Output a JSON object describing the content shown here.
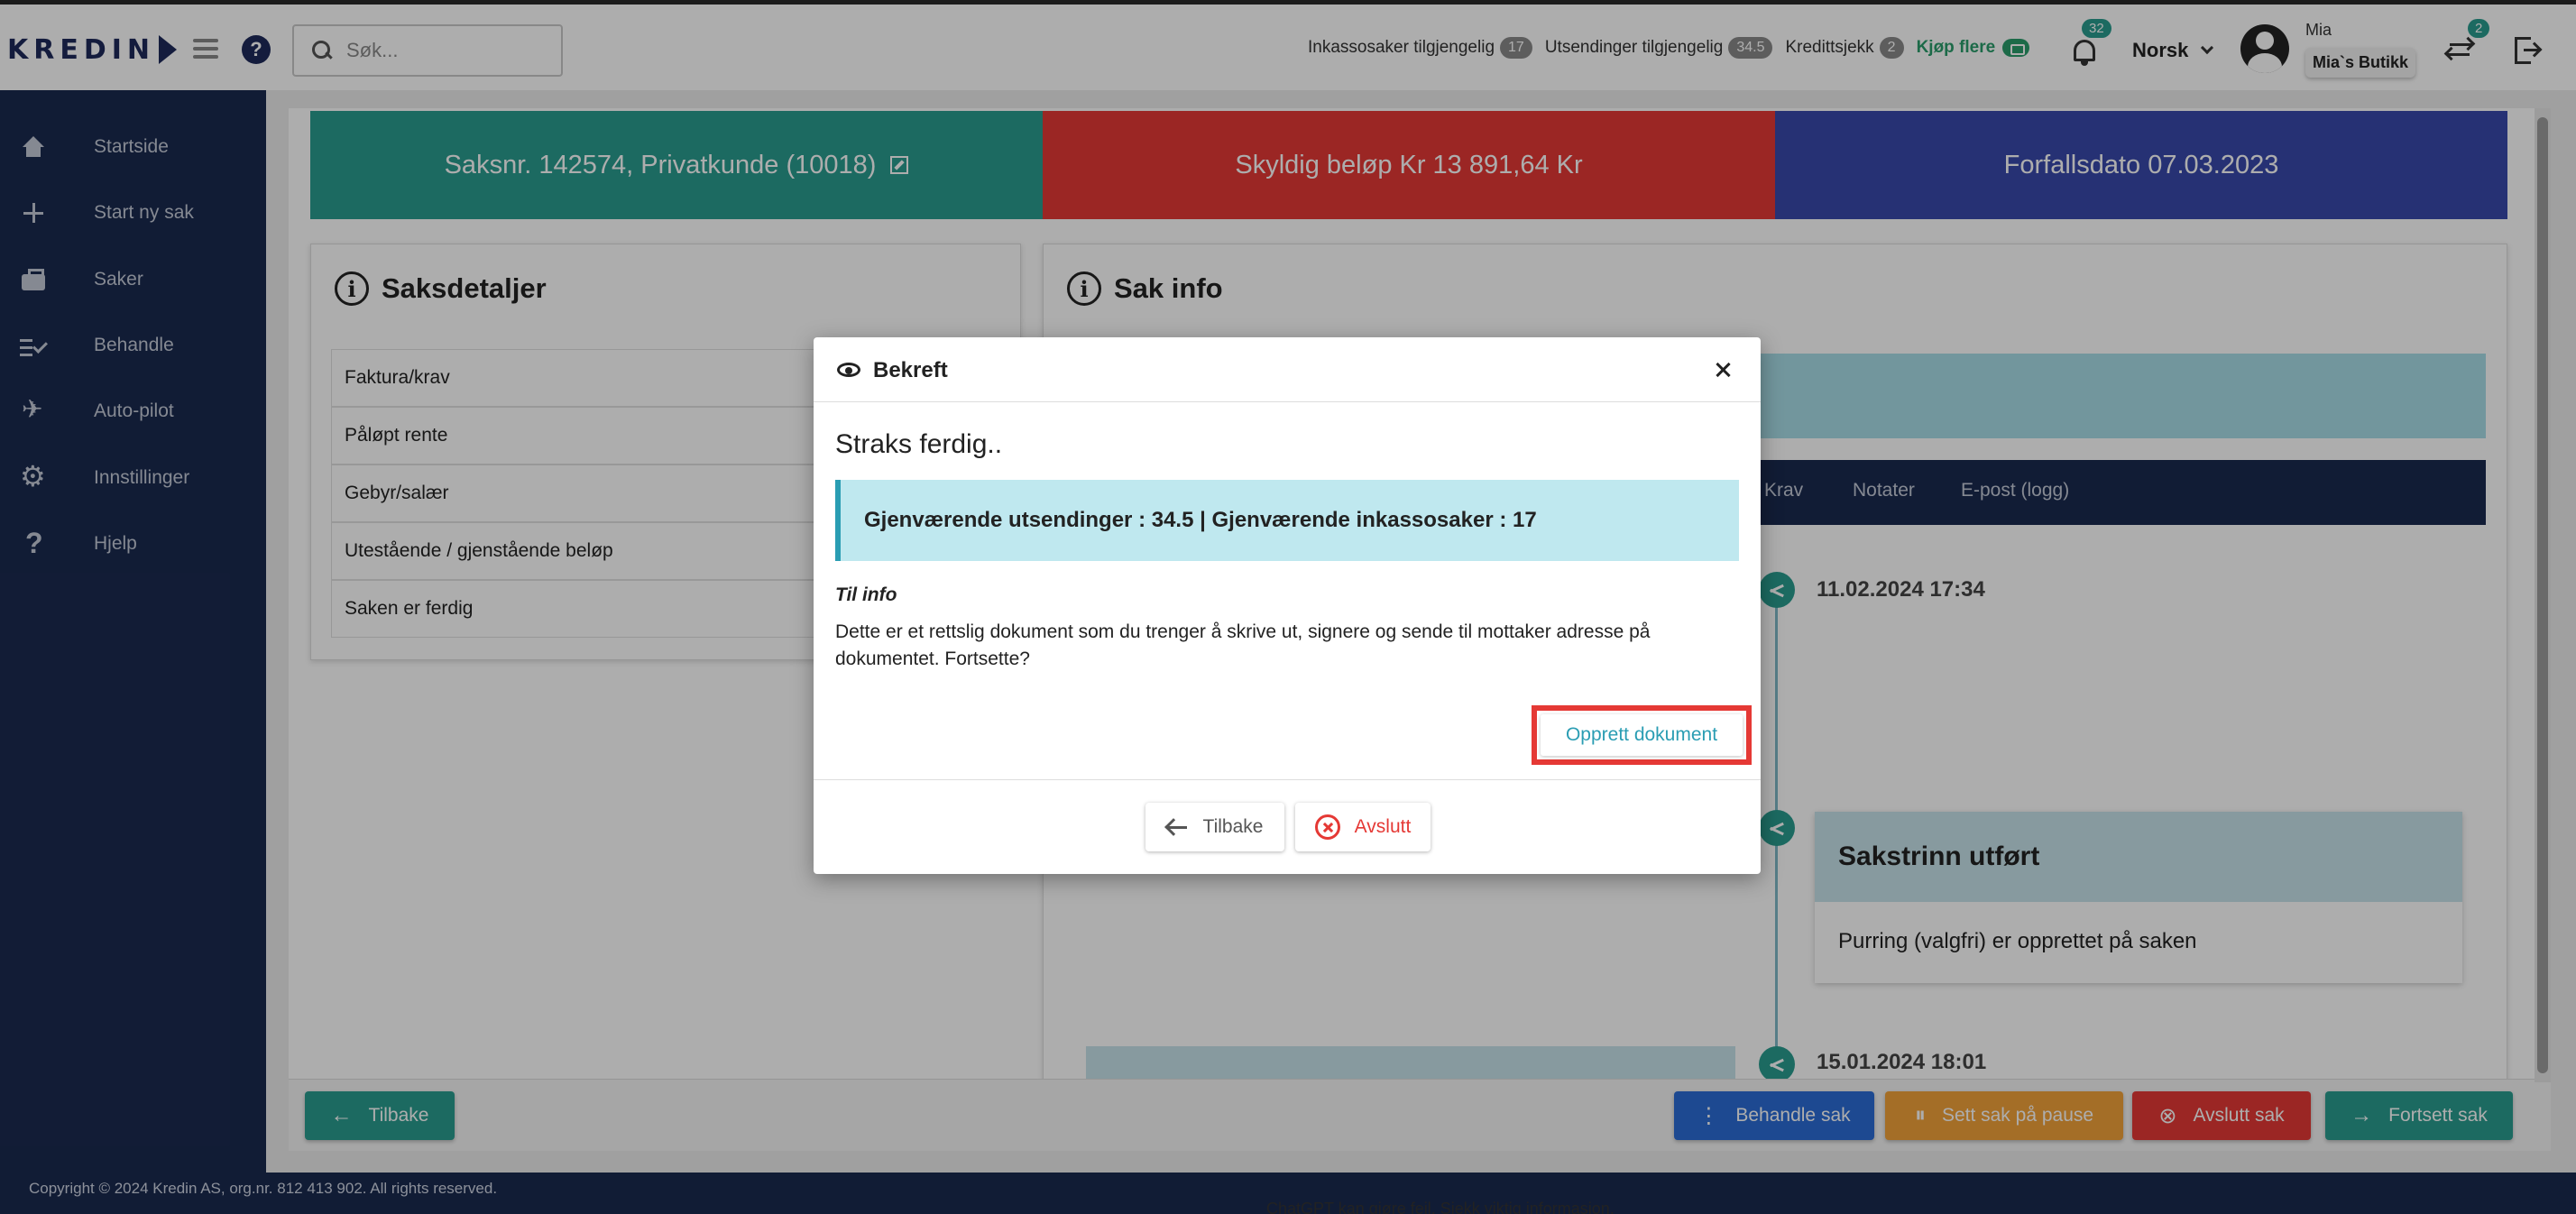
{
  "topbar": {
    "logo": "KREDIN",
    "search_placeholder": "Søk...",
    "stats": [
      {
        "label": "Inkassosaker tilgjengelig",
        "count": "17"
      },
      {
        "label": "Utsendinger tilgjengelig",
        "count": "34.5"
      },
      {
        "label": "Kredittsjekk",
        "count": "2"
      }
    ],
    "buy_more": "Kjøp flere",
    "notifications_count": "32",
    "language": "Norsk",
    "user_name": "Mia",
    "user_shop": "Mia`s Butikk",
    "swap_count": "2"
  },
  "sidebar": {
    "items": [
      {
        "label": "Startside",
        "icon": "home-icon"
      },
      {
        "label": "Start ny sak",
        "icon": "plus-icon"
      },
      {
        "label": "Saker",
        "icon": "briefcase-icon"
      },
      {
        "label": "Behandle",
        "icon": "checklist-icon"
      },
      {
        "label": "Auto-pilot",
        "icon": "airplane-icon"
      },
      {
        "label": "Innstillinger",
        "icon": "gear-icon"
      },
      {
        "label": "Hjelp",
        "icon": "help-icon"
      }
    ]
  },
  "banners": {
    "case": "Saksnr. 142574,  Privatkunde (10018)",
    "amount": "Skyldig beløp Kr 13 891,64 Kr",
    "due": "Forfallsdato  07.03.2023"
  },
  "details_panel": {
    "title": "Saksdetaljer",
    "rows": [
      "Faktura/krav",
      "Påløpt rente",
      "Gebyr/salær",
      "Utestående / gjenstående beløp",
      "Saken er ferdig"
    ]
  },
  "info_panel": {
    "title": "Sak info",
    "tabs": [
      "Krav",
      "Notater",
      "E-post (logg)"
    ],
    "timeline": {
      "date1": "11.02.2024 17:34",
      "step_title": "Sakstrinn utført",
      "step_text": "Purring (valgfri) er opprettet på saken",
      "date2": "15.01.2024 18:01"
    }
  },
  "actions": {
    "back": "Tilbake",
    "handle": "Behandle sak",
    "pause": "Sett sak på pause",
    "close": "Avslutt sak",
    "continue": "Fortsett sak"
  },
  "footer": {
    "copyright": "Copyright © 2024 Kredin AS, org.nr. 812 413 902. All rights reserved.",
    "note": "ChatGPT kan gjøre feil. Sjekk viktig informasjon."
  },
  "modal": {
    "title": "Bekreft",
    "heading": "Straks ferdig..",
    "alert": "Gjenværende utsendinger : 34.5 | Gjenværende inkassosaker : 17",
    "info_label": "Til info",
    "body": "Dette er et rettslig dokument som du trenger å skrive ut, signere og sende til mottaker adresse på dokumentet. Fortsette?",
    "create_button": "Opprett dokument",
    "back_button": "Tilbake",
    "cancel_button": "Avslutt"
  },
  "colors": {
    "sidebar": "#1a2a4f",
    "green": "#2a9d8f",
    "red": "#e53935",
    "blue": "#3949ab",
    "highlight": "#e53935"
  }
}
